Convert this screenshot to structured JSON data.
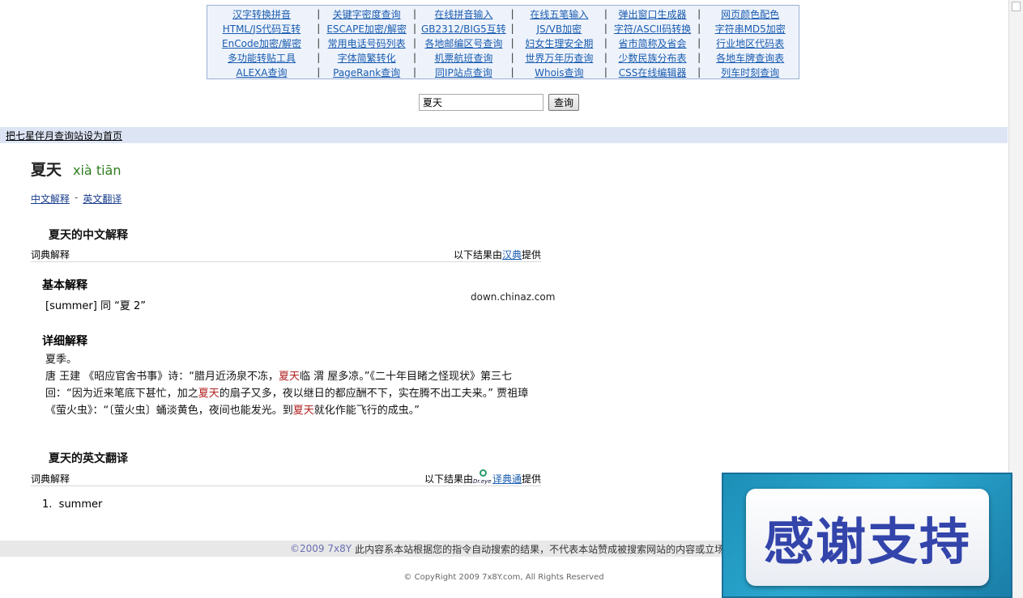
{
  "tools": {
    "rows": [
      [
        "汉字转换拼音",
        "关键字密度查询",
        "在线拼音输入",
        "在线五笔输入",
        "弹出窗口生成器",
        "网页颜色配色"
      ],
      [
        "HTML/JS代码互转",
        "ESCAPE加密/解密",
        "GB2312/BIG5互转",
        "JS/VB加密",
        "字符/ASCII码转换",
        "字符串MD5加密"
      ],
      [
        "EnCode加密/解密",
        "常用电话号码列表",
        "各地邮编区号查询",
        "妇女生理安全期",
        "省市简称及省会",
        "行业地区代码表"
      ],
      [
        "多功能转贴工具",
        "字体简繁转化",
        "机票航班查询",
        "世界万年历查询",
        "少数民族分布表",
        "各地车牌查询表"
      ],
      [
        "ALEXA查询",
        "PageRank查询",
        "同IP站点查询",
        "Whois查询",
        "CSS在线编辑器",
        "列车时刻查询"
      ]
    ],
    "separator": "|"
  },
  "search": {
    "value": "夏天",
    "button": "查询"
  },
  "home_link": "把七星伴月查询站设为首页",
  "entry": {
    "word": "夏天",
    "pinyin": "xià tiān"
  },
  "sublinks": {
    "chinese": "中文解释",
    "dash": "-",
    "english": "英文翻译"
  },
  "cn_section": {
    "title": "夏天的中文解释",
    "dict_label": "词典解释",
    "source_prefix": "以下结果由",
    "source_link": "汉典",
    "source_suffix": "提供"
  },
  "basic": {
    "title": "基本解释",
    "text": "[summer] 同 “夏 2”"
  },
  "watermark": "down.chinaz.com",
  "detail": {
    "title": "详细解释",
    "line1": "夏季。",
    "p1": "唐 王建 《昭应官舍书事》诗：“腊月近汤泉不冻，",
    "hl1": "夏天",
    "p2": "临 渭 屋多凉。”《二十年目睹之怪现状》第三七回：“因为近来笔底下甚忙，加之",
    "hl2": "夏天",
    "p3": "的扇子又多，夜以继日的都应酬不下，实在腾不出工夫来。” 贾祖璋 《萤火虫》：“〔萤火虫〕蛹淡黄色，夜间也能发光。到",
    "hl3": "夏天",
    "p4": "就化作能飞行的成虫。”"
  },
  "en_section": {
    "title": "夏天的英文翻译",
    "dict_label": "词典解释",
    "source_prefix": "以下结果由",
    "logo_text": "Dr.eye",
    "source_link": "译典通",
    "source_suffix": "提供",
    "items": [
      "summer"
    ],
    "item_number": "1."
  },
  "footer": {
    "copy": "©2009 7x8Y",
    "text": "此内容系本站根据您的指令自动搜索的结果，不代表本站赞成被搜索网站的内容或立场",
    "copyright": "© CopyRight 2009 7x8Y.com, All Rights Reserved"
  },
  "thanks": {
    "text": "感谢支持",
    "bg": "#1d8fb7",
    "text_color": "#3344aa"
  }
}
